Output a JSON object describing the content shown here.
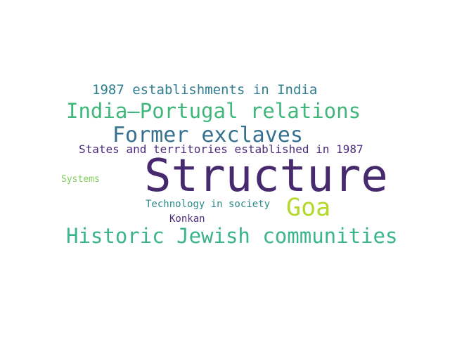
{
  "cloud": {
    "words": [
      {
        "text": "1987 establishments in India",
        "color": "#2f7f8f"
      },
      {
        "text": "India–Portugal relations",
        "color": "#3fb77a"
      },
      {
        "text": "Former exclaves",
        "color": "#35708e"
      },
      {
        "text": "States and territories established in 1987",
        "color": "#4a2a7a"
      },
      {
        "text": "Structure",
        "color": "#472a6e"
      },
      {
        "text": "Systems",
        "color": "#7fcf5a"
      },
      {
        "text": "Goa",
        "color": "#b5d92a"
      },
      {
        "text": "Technology in society",
        "color": "#2b8a8a"
      },
      {
        "text": "Konkan",
        "color": "#4a2f7a"
      },
      {
        "text": "Historic Jewish communities",
        "color": "#3ab58a"
      }
    ]
  }
}
